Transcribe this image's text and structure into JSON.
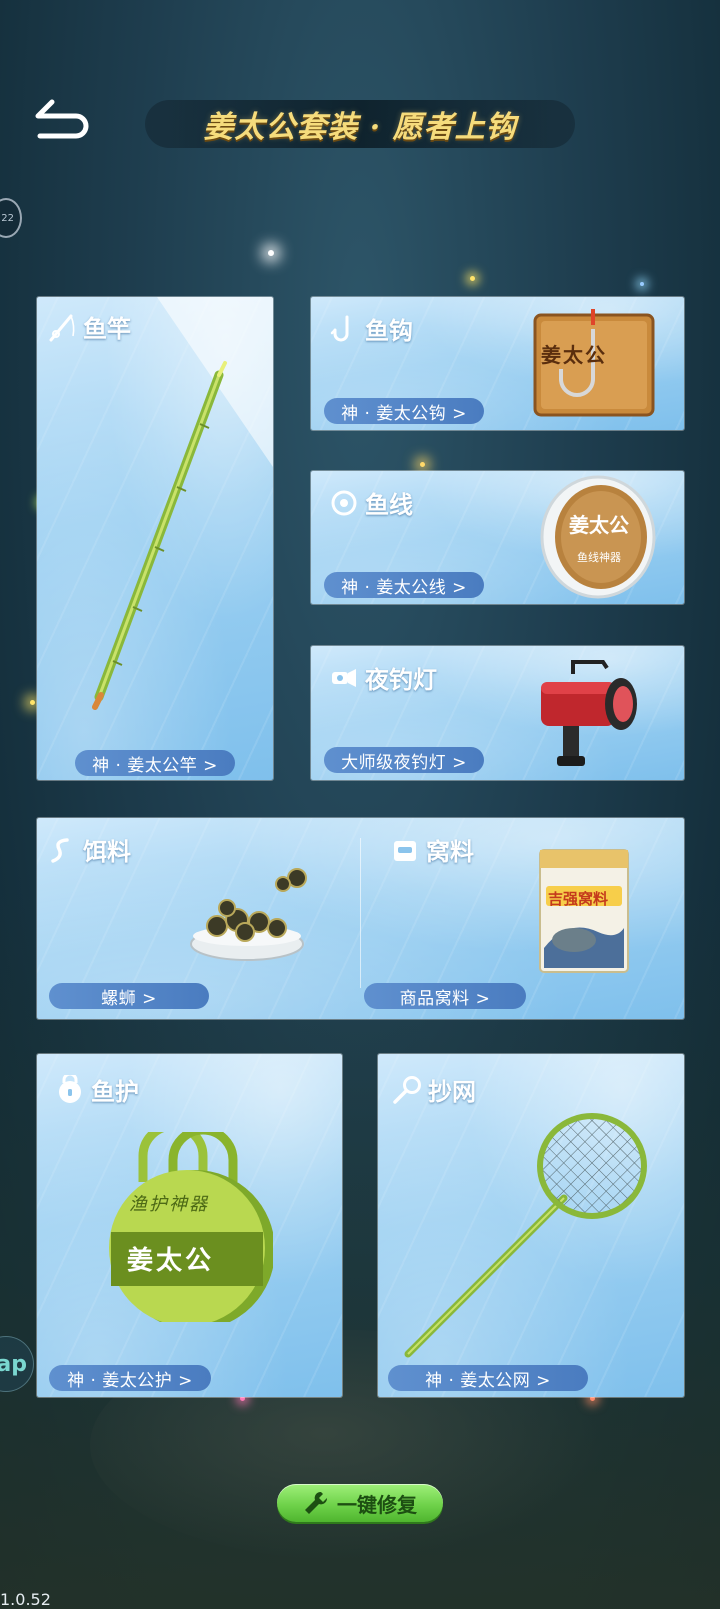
{
  "header": {
    "title": "姜太公套装 · 愿者上钩",
    "side_badge": "22"
  },
  "cards": {
    "rod": {
      "label": "鱼竿",
      "item": "神 · 姜太公竿 >"
    },
    "hook": {
      "label": "鱼钩",
      "item": "神 · 姜太公钩 >",
      "art_text": "姜太公"
    },
    "line": {
      "label": "鱼线",
      "item": "神 · 姜太公线 >",
      "art_text": "姜太公",
      "art_subtext": "鱼线神器"
    },
    "lamp": {
      "label": "夜钓灯",
      "item": "大师级夜钓灯 >"
    },
    "bait": {
      "label": "饵料",
      "item": "螺蛳 >"
    },
    "chum": {
      "label": "窝料",
      "item": "商品窝料 >",
      "art_text": "吉强窝料"
    },
    "keep": {
      "label": "鱼护",
      "item": "神 · 姜太公护 >",
      "art_text": "渔护神器",
      "art_subtext": "姜太公"
    },
    "net": {
      "label": "抄网",
      "item": "神 · 姜太公网 >"
    }
  },
  "repair_button": {
    "label": "一键修复"
  },
  "edge_bubble": "ap",
  "version": "1.0.52",
  "colors": {
    "title_gold": "#f6dc7c",
    "pill_blue": "#4a7cc0",
    "repair_green": "#6fd24a"
  }
}
